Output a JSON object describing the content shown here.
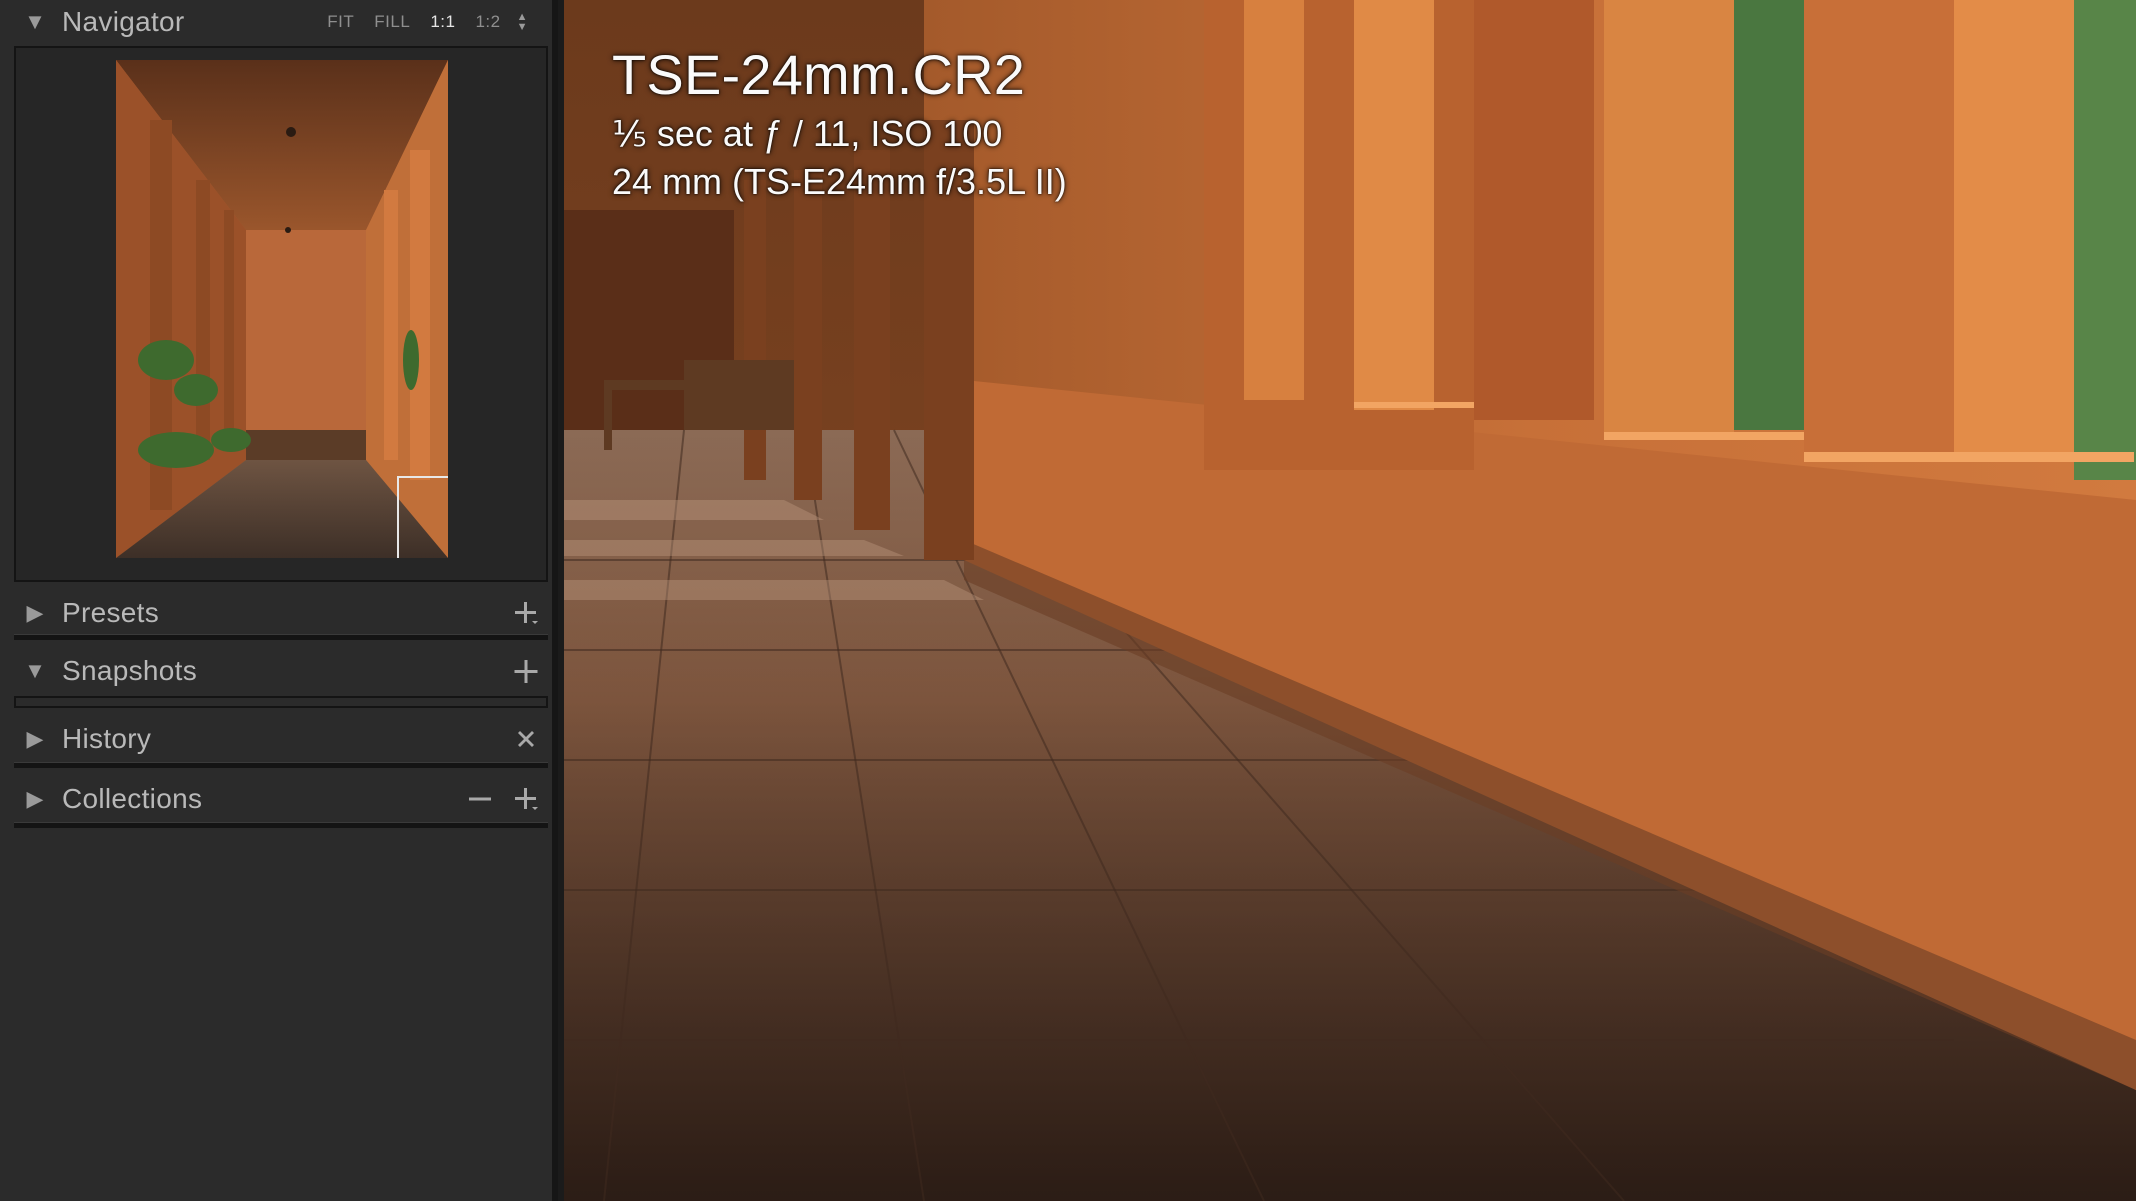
{
  "navigator": {
    "title": "Navigator",
    "zoom_options": [
      "FIT",
      "FILL",
      "1:1",
      "1:2"
    ],
    "zoom_selected": "1:1"
  },
  "panels": [
    {
      "title": "Presets",
      "expanded": false,
      "actions": [
        "plus-menu"
      ]
    },
    {
      "title": "Snapshots",
      "expanded": true,
      "actions": [
        "plus"
      ]
    },
    {
      "title": "History",
      "expanded": false,
      "actions": [
        "close"
      ]
    },
    {
      "title": "Collections",
      "expanded": false,
      "actions": [
        "minus",
        "plus-menu"
      ]
    }
  ],
  "image_info": {
    "filename": "TSE-24mm.CR2",
    "exposure": "⅕ sec at ƒ / 11, ISO 100",
    "lens": "24 mm (TS-E24mm f/3.5L II)"
  },
  "colors": {
    "panel_bg": "#2b2b2b",
    "divider": "#141414",
    "wall": "#c26a33",
    "floor": "#7d5a45"
  },
  "icons": {
    "collapse": "triangle-down-icon",
    "expand": "triangle-right-icon",
    "add": "plus-icon",
    "remove": "minus-icon",
    "clear": "close-icon"
  }
}
